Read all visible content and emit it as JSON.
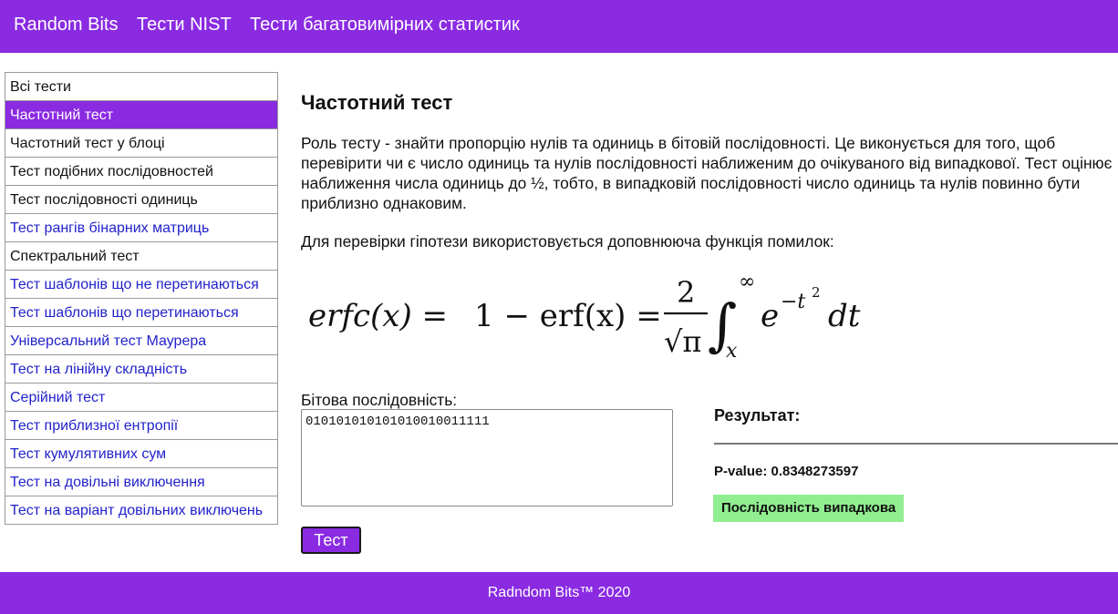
{
  "nav": {
    "brand": "Random Bits",
    "nist": "Тести NIST",
    "multivariate": "Тести багатовимірних статистик"
  },
  "sidebar": {
    "items": [
      {
        "label": "Всі тести"
      },
      {
        "label": "Частотний тест"
      },
      {
        "label": "Частотний тест у блоці"
      },
      {
        "label": "Тест подібних послідовностей"
      },
      {
        "label": "Тест послідовності одиниць"
      },
      {
        "label": "Тест рангів бінарних матриць"
      },
      {
        "label": "Спектральний тест"
      },
      {
        "label": "Тест шаблонів що не перетинаються"
      },
      {
        "label": "Тест шаблонів що перетинаються"
      },
      {
        "label": "Універсальний тест Маурера"
      },
      {
        "label": "Тест на лінійну складність"
      },
      {
        "label": "Серійний тест"
      },
      {
        "label": "Тест приблизної ентропії"
      },
      {
        "label": "Тест кумулятивних сум"
      },
      {
        "label": "Тест на довільні виключення"
      },
      {
        "label": "Тест на варіант довільних виключень"
      }
    ]
  },
  "main": {
    "title": "Частотний тест",
    "description": "Роль тесту - знайти пропорцію нулів та одиниць в бітовій послідовності. Це виконується для того, щоб перевірити чи є число одиниць та нулів послідовності наближеним до очікуваного від випадкової. Тест оцінює наближення числа одиниць до ½, тобто, в випадковій послідовності число одиниць та нулів повинно бути приблизно однаковим.",
    "hint": "Для перевірки гіпотези використовується доповнююча функція помилок:",
    "formula": {
      "lhs": "erfc(x) =",
      "one_minus": "1 − erf(x) =",
      "numerator": "2",
      "denominator": "√π",
      "integral": "∫",
      "upper_limit": "∞",
      "lower_limit": "x",
      "base": "e",
      "exponent": "−t",
      "exponent_power": "2",
      "dt": "dt"
    },
    "sequence_label": "Бітова послідовність:",
    "sequence_value": "010101010101010010011111",
    "test_button": "Тест"
  },
  "result": {
    "title": "Результат:",
    "pvalue": "P-value: 0.8348273597",
    "verdict": "Послідовність випадкова"
  },
  "footer": {
    "text": "Radndom Bits™ 2020"
  },
  "colors": {
    "accent": "#8a2be2",
    "link": "#2222cc",
    "success": "#90ee90"
  }
}
